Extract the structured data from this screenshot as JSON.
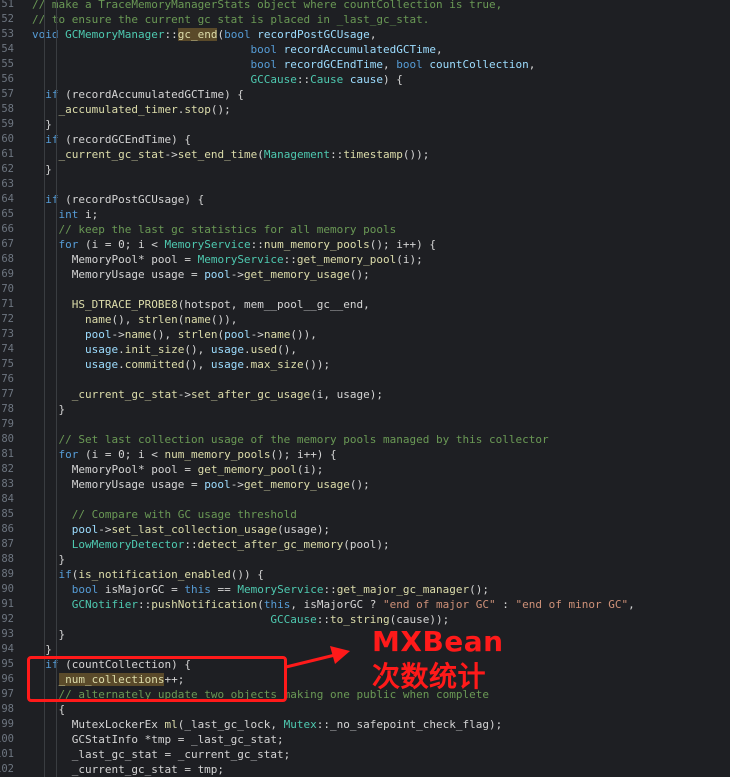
{
  "editor": {
    "lines": [
      {
        "num": "51",
        "tokens": [
          [
            "c",
            "// make a TraceMemoryManagerStats object where countCollection is true,"
          ]
        ]
      },
      {
        "num": "52",
        "tokens": [
          [
            "c",
            "// to ensure the current gc stat is placed in _last_gc_stat."
          ]
        ]
      },
      {
        "num": "53",
        "tokens": [
          [
            "k",
            "void "
          ],
          [
            "t",
            "GCMemoryManager"
          ],
          [
            "p",
            "::"
          ],
          [
            "f hl",
            "gc_end"
          ],
          [
            "p",
            "("
          ],
          [
            "k",
            "bool "
          ],
          [
            "v",
            "recordPostGCUsage"
          ],
          [
            "p",
            ","
          ]
        ]
      },
      {
        "num": "54",
        "tokens": [
          [
            "p",
            "                                 "
          ],
          [
            "k",
            "bool "
          ],
          [
            "v",
            "recordAccumulatedGCTime"
          ],
          [
            "p",
            ","
          ]
        ]
      },
      {
        "num": "55",
        "tokens": [
          [
            "p",
            "                                 "
          ],
          [
            "k",
            "bool "
          ],
          [
            "v",
            "recordGCEndTime"
          ],
          [
            "p",
            ", "
          ],
          [
            "k",
            "bool "
          ],
          [
            "v",
            "countCollection"
          ],
          [
            "p",
            ","
          ]
        ]
      },
      {
        "num": "56",
        "tokens": [
          [
            "p",
            "                                 "
          ],
          [
            "t",
            "GCCause"
          ],
          [
            "p",
            "::"
          ],
          [
            "t",
            "Cause "
          ],
          [
            "v",
            "cause"
          ],
          [
            "p",
            ") {"
          ]
        ]
      },
      {
        "num": "57",
        "tokens": [
          [
            "p",
            "  "
          ],
          [
            "k",
            "if "
          ],
          [
            "p",
            "(recordAccumulatedGCTime) {"
          ]
        ]
      },
      {
        "num": "58",
        "tokens": [
          [
            "p",
            "    "
          ],
          [
            "f",
            "_accumulated_timer"
          ],
          [
            "p",
            "."
          ],
          [
            "f",
            "stop"
          ],
          [
            "p",
            "();"
          ]
        ]
      },
      {
        "num": "59",
        "tokens": [
          [
            "p",
            "  }"
          ]
        ]
      },
      {
        "num": "60",
        "tokens": [
          [
            "p",
            "  "
          ],
          [
            "k",
            "if "
          ],
          [
            "p",
            "(recordGCEndTime) {"
          ]
        ]
      },
      {
        "num": "61",
        "tokens": [
          [
            "p",
            "    "
          ],
          [
            "f",
            "_current_gc_stat"
          ],
          [
            "p",
            "->"
          ],
          [
            "f",
            "set_end_time"
          ],
          [
            "p",
            "("
          ],
          [
            "t",
            "Management"
          ],
          [
            "p",
            "::"
          ],
          [
            "f",
            "timestamp"
          ],
          [
            "p",
            "());"
          ]
        ]
      },
      {
        "num": "62",
        "tokens": [
          [
            "p",
            "  }"
          ]
        ]
      },
      {
        "num": "63",
        "tokens": [
          [
            "p",
            ""
          ]
        ]
      },
      {
        "num": "64",
        "tokens": [
          [
            "p",
            "  "
          ],
          [
            "k",
            "if "
          ],
          [
            "p",
            "(recordPostGCUsage) {"
          ]
        ]
      },
      {
        "num": "65",
        "tokens": [
          [
            "p",
            "    "
          ],
          [
            "k",
            "int "
          ],
          [
            "p",
            "i;"
          ]
        ]
      },
      {
        "num": "66",
        "tokens": [
          [
            "p",
            "    "
          ],
          [
            "c",
            "// keep the last gc statistics for all memory pools"
          ]
        ]
      },
      {
        "num": "67",
        "tokens": [
          [
            "p",
            "    "
          ],
          [
            "k",
            "for "
          ],
          [
            "p",
            "(i = 0; i < "
          ],
          [
            "t",
            "MemoryService"
          ],
          [
            "p",
            "::"
          ],
          [
            "f",
            "num_memory_pools"
          ],
          [
            "p",
            "(); i++) {"
          ]
        ]
      },
      {
        "num": "68",
        "tokens": [
          [
            "p",
            "      MemoryPool* pool = "
          ],
          [
            "t",
            "MemoryService"
          ],
          [
            "p",
            "::"
          ],
          [
            "f",
            "get_memory_pool"
          ],
          [
            "p",
            "(i);"
          ]
        ]
      },
      {
        "num": "69",
        "tokens": [
          [
            "p",
            "      MemoryUsage usage = "
          ],
          [
            "v",
            "pool"
          ],
          [
            "p",
            "->"
          ],
          [
            "f",
            "get_memory_usage"
          ],
          [
            "p",
            "();"
          ]
        ]
      },
      {
        "num": "70",
        "tokens": [
          [
            "p",
            ""
          ]
        ]
      },
      {
        "num": "71",
        "tokens": [
          [
            "p",
            "      "
          ],
          [
            "f",
            "HS_DTRACE_PROBE8"
          ],
          [
            "p",
            "(hotspot, mem__pool__gc__end,"
          ]
        ]
      },
      {
        "num": "72",
        "tokens": [
          [
            "p",
            "        "
          ],
          [
            "f",
            "name"
          ],
          [
            "p",
            "(), "
          ],
          [
            "f",
            "strlen"
          ],
          [
            "p",
            "("
          ],
          [
            "f",
            "name"
          ],
          [
            "p",
            "()),"
          ]
        ]
      },
      {
        "num": "73",
        "tokens": [
          [
            "p",
            "        "
          ],
          [
            "v",
            "pool"
          ],
          [
            "p",
            "->"
          ],
          [
            "f",
            "name"
          ],
          [
            "p",
            "(), "
          ],
          [
            "f",
            "strlen"
          ],
          [
            "p",
            "("
          ],
          [
            "v",
            "pool"
          ],
          [
            "p",
            "->"
          ],
          [
            "f",
            "name"
          ],
          [
            "p",
            "()),"
          ]
        ]
      },
      {
        "num": "74",
        "tokens": [
          [
            "p",
            "        "
          ],
          [
            "v",
            "usage"
          ],
          [
            "p",
            "."
          ],
          [
            "f",
            "init_size"
          ],
          [
            "p",
            "(), "
          ],
          [
            "v",
            "usage"
          ],
          [
            "p",
            "."
          ],
          [
            "f",
            "used"
          ],
          [
            "p",
            "(),"
          ]
        ]
      },
      {
        "num": "75",
        "tokens": [
          [
            "p",
            "        "
          ],
          [
            "v",
            "usage"
          ],
          [
            "p",
            "."
          ],
          [
            "f",
            "committed"
          ],
          [
            "p",
            "(), "
          ],
          [
            "v",
            "usage"
          ],
          [
            "p",
            "."
          ],
          [
            "f",
            "max_size"
          ],
          [
            "p",
            "());"
          ]
        ]
      },
      {
        "num": "76",
        "tokens": [
          [
            "p",
            ""
          ]
        ]
      },
      {
        "num": "77",
        "tokens": [
          [
            "p",
            "      "
          ],
          [
            "f",
            "_current_gc_stat"
          ],
          [
            "p",
            "->"
          ],
          [
            "f",
            "set_after_gc_usage"
          ],
          [
            "p",
            "(i, usage);"
          ]
        ]
      },
      {
        "num": "78",
        "tokens": [
          [
            "p",
            "    }"
          ]
        ]
      },
      {
        "num": "79",
        "tokens": [
          [
            "p",
            ""
          ]
        ]
      },
      {
        "num": "80",
        "tokens": [
          [
            "p",
            "    "
          ],
          [
            "c",
            "// Set last collection usage of the memory pools managed by this collector"
          ]
        ]
      },
      {
        "num": "81",
        "tokens": [
          [
            "p",
            "    "
          ],
          [
            "k",
            "for "
          ],
          [
            "p",
            "(i = 0; i < "
          ],
          [
            "f",
            "num_memory_pools"
          ],
          [
            "p",
            "(); i++) {"
          ]
        ]
      },
      {
        "num": "82",
        "tokens": [
          [
            "p",
            "      MemoryPool* pool = "
          ],
          [
            "f",
            "get_memory_pool"
          ],
          [
            "p",
            "(i);"
          ]
        ]
      },
      {
        "num": "83",
        "tokens": [
          [
            "p",
            "      MemoryUsage usage = "
          ],
          [
            "v",
            "pool"
          ],
          [
            "p",
            "->"
          ],
          [
            "f",
            "get_memory_usage"
          ],
          [
            "p",
            "();"
          ]
        ]
      },
      {
        "num": "84",
        "tokens": [
          [
            "p",
            ""
          ]
        ]
      },
      {
        "num": "85",
        "tokens": [
          [
            "p",
            "      "
          ],
          [
            "c",
            "// Compare with GC usage threshold"
          ]
        ]
      },
      {
        "num": "86",
        "tokens": [
          [
            "p",
            "      "
          ],
          [
            "v",
            "pool"
          ],
          [
            "p",
            "->"
          ],
          [
            "f",
            "set_last_collection_usage"
          ],
          [
            "p",
            "(usage);"
          ]
        ]
      },
      {
        "num": "87",
        "tokens": [
          [
            "p",
            "      "
          ],
          [
            "t",
            "LowMemoryDetector"
          ],
          [
            "p",
            "::"
          ],
          [
            "f",
            "detect_after_gc_memory"
          ],
          [
            "p",
            "(pool);"
          ]
        ]
      },
      {
        "num": "88",
        "tokens": [
          [
            "p",
            "    }"
          ]
        ]
      },
      {
        "num": "89",
        "tokens": [
          [
            "p",
            "    "
          ],
          [
            "k",
            "if"
          ],
          [
            "p",
            "("
          ],
          [
            "f",
            "is_notification_enabled"
          ],
          [
            "p",
            "()) {"
          ]
        ]
      },
      {
        "num": "90",
        "tokens": [
          [
            "p",
            "      "
          ],
          [
            "k",
            "bool "
          ],
          [
            "p",
            "isMajorGC = "
          ],
          [
            "k",
            "this "
          ],
          [
            "p",
            "== "
          ],
          [
            "t",
            "MemoryService"
          ],
          [
            "p",
            "::"
          ],
          [
            "f",
            "get_major_gc_manager"
          ],
          [
            "p",
            "();"
          ]
        ]
      },
      {
        "num": "91",
        "tokens": [
          [
            "p",
            "      "
          ],
          [
            "t",
            "GCNotifier"
          ],
          [
            "p",
            "::"
          ],
          [
            "f",
            "pushNotification"
          ],
          [
            "p",
            "("
          ],
          [
            "k",
            "this"
          ],
          [
            "p",
            ", isMajorGC ? "
          ],
          [
            "s",
            "\"end of major GC\""
          ],
          [
            "p",
            " : "
          ],
          [
            "s",
            "\"end of minor GC\""
          ],
          [
            "p",
            ","
          ]
        ]
      },
      {
        "num": "92",
        "tokens": [
          [
            "p",
            "                                    "
          ],
          [
            "t",
            "GCCause"
          ],
          [
            "p",
            "::"
          ],
          [
            "f",
            "to_string"
          ],
          [
            "p",
            "(cause));"
          ]
        ]
      },
      {
        "num": "93",
        "tokens": [
          [
            "p",
            "    }"
          ]
        ]
      },
      {
        "num": "94",
        "tokens": [
          [
            "p",
            "  }"
          ]
        ]
      },
      {
        "num": "95",
        "tokens": [
          [
            "p",
            "  "
          ],
          [
            "k",
            "if "
          ],
          [
            "p",
            "(countCollection) {"
          ]
        ]
      },
      {
        "num": "96",
        "tokens": [
          [
            "p",
            "    "
          ],
          [
            "f hl",
            "_num_collections"
          ],
          [
            "p",
            "++;"
          ]
        ]
      },
      {
        "num": "97",
        "tokens": [
          [
            "p",
            "    "
          ],
          [
            "c",
            "// alternately update two objects making one public when complete"
          ]
        ]
      },
      {
        "num": "98",
        "tokens": [
          [
            "p",
            "    {"
          ]
        ]
      },
      {
        "num": "99",
        "tokens": [
          [
            "p",
            "      MutexLockerEx "
          ],
          [
            "f",
            "ml"
          ],
          [
            "p",
            "(_last_gc_lock, "
          ],
          [
            "t",
            "Mutex"
          ],
          [
            "p",
            "::_no_safepoint_check_flag);"
          ]
        ]
      },
      {
        "num": "100",
        "tokens": [
          [
            "p",
            "      GCStatInfo *tmp = _last_gc_stat;"
          ]
        ]
      },
      {
        "num": "101",
        "tokens": [
          [
            "p",
            "      _last_gc_stat = _current_gc_stat;"
          ]
        ]
      },
      {
        "num": "102",
        "tokens": [
          [
            "p",
            "      _current_gc_stat = tmp;"
          ]
        ]
      }
    ]
  },
  "annotation": {
    "line1": "MXBean",
    "line2": "次数统计",
    "color": "#ff1a1a"
  }
}
